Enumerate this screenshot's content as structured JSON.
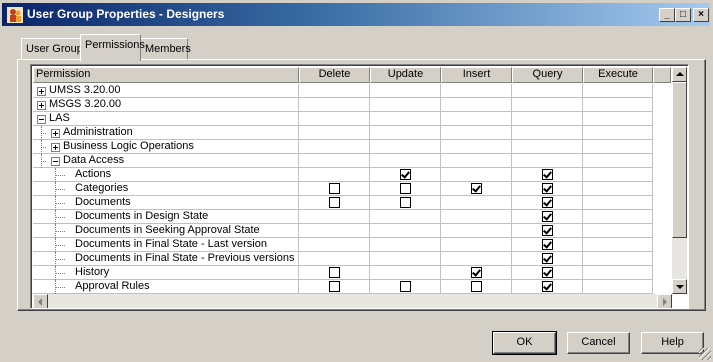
{
  "window": {
    "title": "User Group Properties - Designers"
  },
  "tabs": [
    {
      "label": "User Group",
      "active": false
    },
    {
      "label": "Permissions",
      "active": true
    },
    {
      "label": "Members",
      "active": false
    }
  ],
  "grid": {
    "columns": [
      "Permission",
      "Delete",
      "Update",
      "Insert",
      "Query",
      "Execute"
    ],
    "rows": [
      {
        "label": "UMSS 3.20.00",
        "level": 0,
        "expander": "plus",
        "delete": null,
        "update": null,
        "insert": null,
        "query": null,
        "execute": null
      },
      {
        "label": "MSGS 3.20.00",
        "level": 0,
        "expander": "plus",
        "delete": null,
        "update": null,
        "insert": null,
        "query": null,
        "execute": null
      },
      {
        "label": "LAS",
        "level": 0,
        "expander": "minus",
        "delete": null,
        "update": null,
        "insert": null,
        "query": null,
        "execute": null
      },
      {
        "label": "Administration",
        "level": 1,
        "expander": "plus",
        "delete": null,
        "update": null,
        "insert": null,
        "query": null,
        "execute": null
      },
      {
        "label": "Business Logic Operations",
        "level": 1,
        "expander": "plus",
        "delete": null,
        "update": null,
        "insert": null,
        "query": null,
        "execute": null
      },
      {
        "label": "Data Access",
        "level": 1,
        "expander": "minus",
        "delete": null,
        "update": null,
        "insert": null,
        "query": null,
        "execute": null
      },
      {
        "label": "Actions",
        "level": 2,
        "expander": null,
        "delete": null,
        "update": true,
        "insert": null,
        "query": true,
        "execute": null
      },
      {
        "label": "Categories",
        "level": 2,
        "expander": null,
        "delete": false,
        "update": false,
        "insert": true,
        "query": true,
        "execute": null
      },
      {
        "label": "Documents",
        "level": 2,
        "expander": null,
        "delete": false,
        "update": false,
        "insert": null,
        "query": true,
        "execute": null
      },
      {
        "label": "Documents in Design State",
        "level": 2,
        "expander": null,
        "delete": null,
        "update": null,
        "insert": null,
        "query": true,
        "execute": null
      },
      {
        "label": "Documents in Seeking Approval State",
        "level": 2,
        "expander": null,
        "delete": null,
        "update": null,
        "insert": null,
        "query": true,
        "execute": null
      },
      {
        "label": "Documents in Final State - Last version",
        "level": 2,
        "expander": null,
        "delete": null,
        "update": null,
        "insert": null,
        "query": true,
        "execute": null
      },
      {
        "label": "Documents in Final State - Previous versions",
        "level": 2,
        "expander": null,
        "delete": null,
        "update": null,
        "insert": null,
        "query": true,
        "execute": null
      },
      {
        "label": "History",
        "level": 2,
        "expander": null,
        "delete": false,
        "update": null,
        "insert": true,
        "query": true,
        "execute": null
      },
      {
        "label": "Approval Rules",
        "level": 2,
        "expander": null,
        "delete": false,
        "update": false,
        "insert": false,
        "query": true,
        "execute": null
      }
    ]
  },
  "buttons": {
    "ok": "OK",
    "cancel": "Cancel",
    "help": "Help"
  },
  "titlebar_buttons": {
    "minimize": "_",
    "maximize": "□",
    "close": "×"
  },
  "colors": {
    "titlebar_start": "#0a246a",
    "titlebar_end": "#a6caf0",
    "face": "#d4d0c8"
  }
}
